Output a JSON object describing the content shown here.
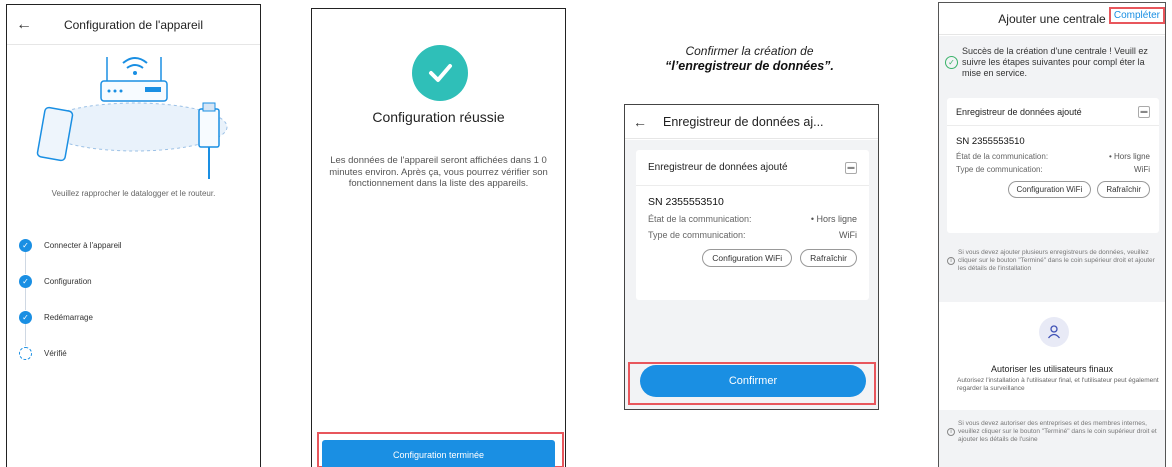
{
  "panel1": {
    "title": "Configuration de l'appareil",
    "back_icon": "←",
    "hint": "Veuillez rapprocher le datalogger et le routeur.",
    "steps": [
      {
        "label": "Connecter à l'appareil",
        "status": "done"
      },
      {
        "label": "Configuration",
        "status": "done"
      },
      {
        "label": "Redémarrage",
        "status": "done"
      },
      {
        "label": "Vérifié",
        "status": "pending"
      }
    ]
  },
  "panel2": {
    "title": "Configuration réussie",
    "description": "Les données de l'appareil seront affichées dans 1 0 minutes environ. Après ça, vous pourrez vérifier son fonctionnement dans la liste des appareils.",
    "done_button": "Configuration terminée"
  },
  "caption": {
    "line1": "Confirmer la création de",
    "line2": "“l’enregistreur de données”."
  },
  "panel3": {
    "title": "Enregistreur de données aj...",
    "back_icon": "←",
    "card": {
      "heading": "Enregistreur de données ajouté",
      "sn": "SN 2355553510",
      "comm_state_label": "État de la communication:",
      "comm_state_value": "• Hors ligne",
      "comm_type_label": "Type de communication:",
      "comm_type_value": "WiFi",
      "wifi_button": "Configuration WiFi",
      "refresh_button": "Rafraîchir"
    },
    "confirm_button": "Confirmer"
  },
  "panel4": {
    "title": "Ajouter une centrale",
    "complete_button": "Compléter",
    "success_message": "Succès de la création d'une centrale ! Veuill ez suivre les étapes suivantes pour compl éter la mise en service.",
    "card": {
      "heading": "Enregistreur de données ajouté",
      "sn": "SN 2355553510",
      "comm_state_label": "État de la communication:",
      "comm_state_value": "• Hors ligne",
      "comm_type_label": "Type de communication:",
      "comm_type_value": "WiFi",
      "wifi_button": "Configuration WiFi",
      "refresh_button": "Rafraîchir"
    },
    "note1": "Si vous devez ajouter plusieurs enregistreurs de données, veuillez cliquer sur le bouton \"Terminé\" dans le coin supérieur droit et ajouter les détails de l'installation",
    "auth_title": "Autoriser les utilisateurs finaux",
    "auth_desc": "Autorisez l'installation à l'utilisateur final, et l'utilisateur peut également regarder la surveillance",
    "note2": "Si vous devez autoriser des entreprises et des membres internes, veuillez cliquer sur le bouton \"Terminé\" dans le coin supérieur droit et ajouter les détails de l'usine"
  },
  "colors": {
    "accent": "#1a8fe3",
    "success": "#2fbfb8",
    "highlight": "#e8565c"
  }
}
